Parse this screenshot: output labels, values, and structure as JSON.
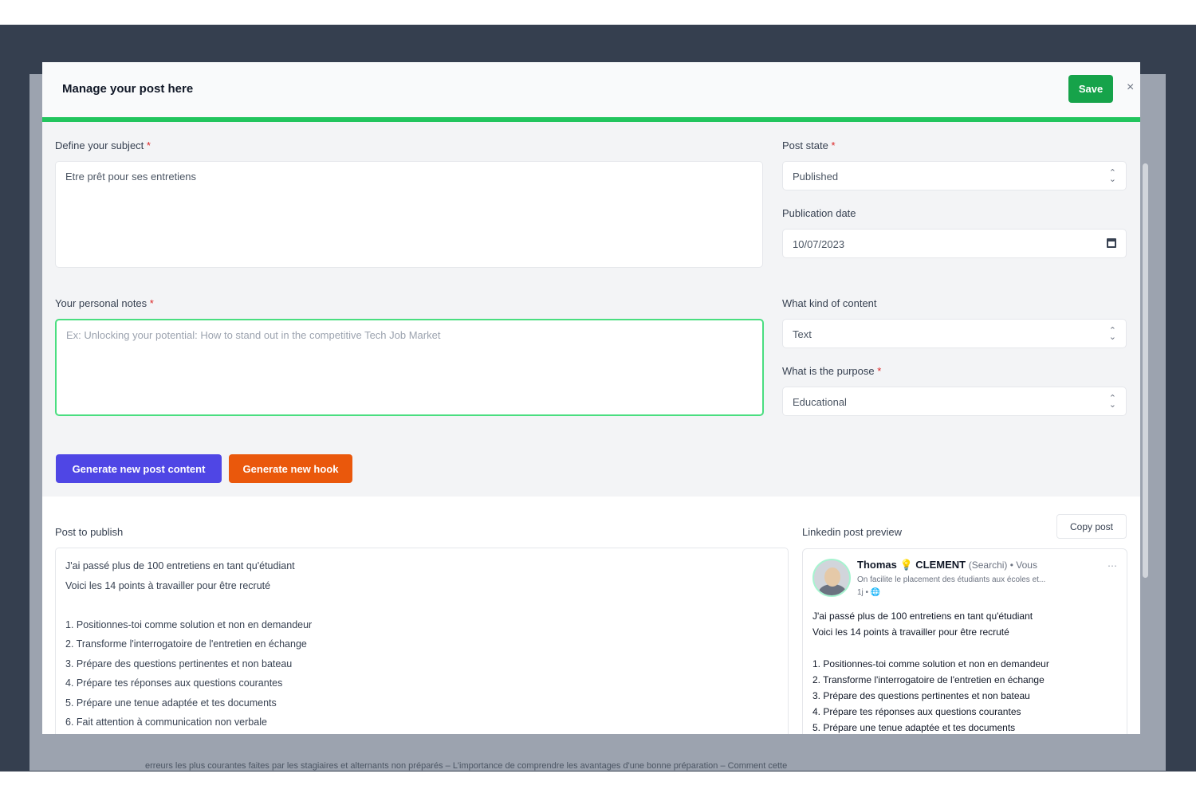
{
  "modal": {
    "title": "Manage your post here",
    "save_label": "Save",
    "close_label": "×"
  },
  "form": {
    "subject_label": "Define your subject",
    "subject_value": "Etre prêt pour ses entretiens",
    "notes_label": "Your personal notes",
    "notes_placeholder": "Ex: Unlocking your potential: How to stand out in the competitive Tech Job Market",
    "post_state_label": "Post state",
    "post_state_value": "Published",
    "publication_date_label": "Publication date",
    "publication_date_value": "10/07/2023",
    "content_kind_label": "What kind of content",
    "content_kind_value": "Text",
    "purpose_label": "What is the purpose",
    "purpose_value": "Educational",
    "required_mark": "*"
  },
  "actions": {
    "generate_content_label": "Generate new post content",
    "generate_hook_label": "Generate new hook"
  },
  "post": {
    "label": "Post to publish",
    "lines": [
      "J'ai passé plus de 100 entretiens en tant qu'étudiant",
      "Voici les 14 points à travailler pour être recruté",
      "",
      "1. Positionnes-toi comme solution et non en demandeur",
      "2. Transforme l'interrogatoire de l'entretien en échange",
      "3. Prépare des questions pertinentes et non bateau",
      "4. Prépare tes réponses aux questions courantes",
      "5. Prépare une tenue adaptée et tes documents",
      "6. Fait attention à communication non verbale"
    ]
  },
  "preview": {
    "label": "Linkedin post preview",
    "copy_label": "Copy post",
    "author_name": "Thomas 💡 CLEMENT",
    "author_meta": "(Searchi) • Vous",
    "author_tagline": "On facilite le placement des étudiants aux écoles et...",
    "post_time": "1j • 🌐",
    "more": "⋯",
    "lines": [
      "J'ai passé plus de 100 entretiens en tant qu'étudiant",
      "Voici les 14 points à travailler pour être recruté",
      "",
      "1. Positionnes-toi comme solution et non en demandeur",
      "2. Transforme l'interrogatoire de l'entretien en échange",
      "3. Prépare des questions pertinentes et non bateau",
      "4. Prépare tes réponses aux questions courantes",
      "5. Prépare une tenue adaptée et tes documents"
    ]
  },
  "backdrop": {
    "bottom_text": "erreurs les plus courantes faites par les stagiaires et alternants non préparés – L'importance de comprendre les avantages d'une bonne préparation – Comment cette"
  },
  "colors": {
    "save": "#16a34a",
    "progress": "#22c55e",
    "generate_content": "#4f46e5",
    "generate_hook": "#ea580c",
    "frame": "#353f4f"
  }
}
